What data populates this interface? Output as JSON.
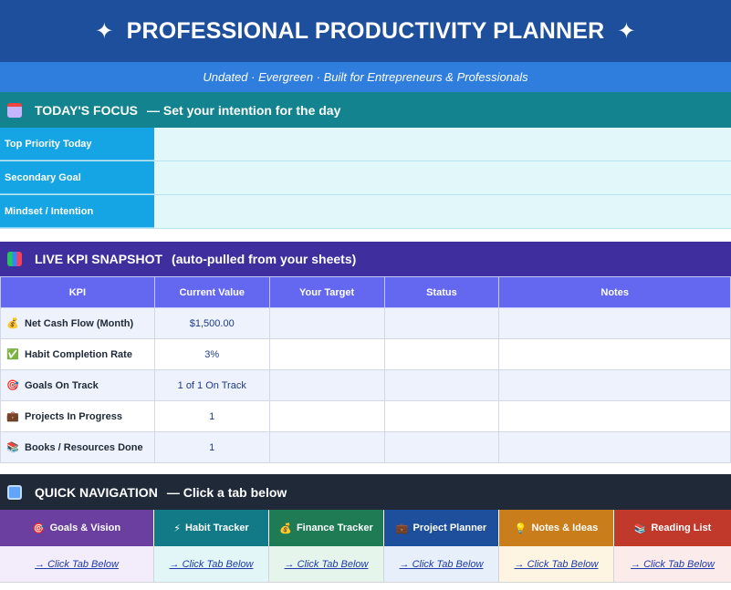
{
  "header": {
    "title": "PROFESSIONAL PRODUCTIVITY PLANNER",
    "star": "✦",
    "subtitle": "Undated · Evergreen · Built for Entrepreneurs & Professionals"
  },
  "focus": {
    "heading": "TODAY'S FOCUS",
    "heading_note": "— Set your intention for the day",
    "icon": "calendar-icon",
    "rows": [
      {
        "label": "Top Priority Today",
        "value": ""
      },
      {
        "label": "Secondary Goal",
        "value": ""
      },
      {
        "label": "Mindset / Intention",
        "value": ""
      }
    ]
  },
  "kpi": {
    "heading": "LIVE KPI SNAPSHOT",
    "heading_note": "(auto-pulled from your sheets)",
    "icon": "bar-chart-icon",
    "columns": [
      "KPI",
      "Current Value",
      "Your Target",
      "Status",
      "Notes"
    ],
    "rows": [
      {
        "icon": "money-bag-icon",
        "glyph": "💰",
        "name": "Net Cash Flow (Month)",
        "current": "$1,500.00",
        "target": "",
        "status": "",
        "notes": ""
      },
      {
        "icon": "check-icon",
        "glyph": "✅",
        "name": "Habit Completion Rate",
        "current": "3%",
        "target": "",
        "status": "",
        "notes": ""
      },
      {
        "icon": "target-icon",
        "glyph": "🎯",
        "name": "Goals On Track",
        "current": "1 of 1 On Track",
        "target": "",
        "status": "",
        "notes": ""
      },
      {
        "icon": "briefcase-icon",
        "glyph": "💼",
        "name": "Projects In Progress",
        "current": "1",
        "target": "",
        "status": "",
        "notes": ""
      },
      {
        "icon": "books-icon",
        "glyph": "📚",
        "name": "Books / Resources Done",
        "current": "1",
        "target": "",
        "status": "",
        "notes": ""
      }
    ]
  },
  "nav": {
    "heading": "QUICK NAVIGATION",
    "heading_note": "— Click a tab below",
    "icon": "book-icon",
    "link_text": "→ Click Tab Below",
    "tabs": [
      {
        "label": "Goals & Vision",
        "icon": "target-icon",
        "glyph": "🎯",
        "color": "#6b3fa0",
        "link_bg": "#f3ecfb"
      },
      {
        "label": "Habit Tracker",
        "icon": "lightning-icon",
        "glyph": "⚡",
        "color": "#127a86",
        "link_bg": "#e3f6f7"
      },
      {
        "label": "Finance Tracker",
        "icon": "money-bag-icon",
        "glyph": "💰",
        "color": "#1e7b54",
        "link_bg": "#e6f5ec"
      },
      {
        "label": "Project Planner",
        "icon": "briefcase-icon",
        "glyph": "💼",
        "color": "#1e4f9c",
        "link_bg": "#e7effb"
      },
      {
        "label": "Notes & Ideas",
        "icon": "lightbulb-icon",
        "glyph": "💡",
        "color": "#c97d1b",
        "link_bg": "#fdf4e2"
      },
      {
        "label": "Reading List",
        "icon": "books-icon",
        "glyph": "📚",
        "color": "#c0392b",
        "link_bg": "#fbeceb"
      }
    ]
  }
}
